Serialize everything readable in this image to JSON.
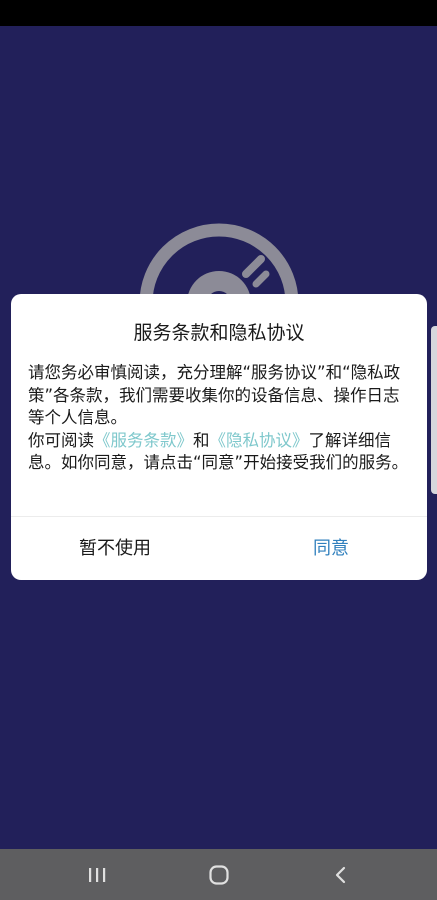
{
  "dialog": {
    "title": "服务条款和隐私协议",
    "body_line1": "请您务必审慎阅读，充分理解“服务协议”和“隐私政策”各条款，我们需要收集你的设备信息、操作日志等个人信息。",
    "body_prefix": "你可阅读",
    "link_terms": "《服务条款》",
    "body_and": "和",
    "link_privacy": "《隐私协议》",
    "body_suffix": "了解详细信息。如你同意，请点击“同意”开始接受我们的服务。",
    "decline_label": "暂不使用",
    "agree_label": "同意"
  },
  "nav": {
    "recents_icon": "recents-icon",
    "home_icon": "home-icon",
    "back_icon": "back-icon"
  },
  "colors": {
    "background": "#22205a",
    "accent": "#2f7fbd",
    "link": "#7fc8cc",
    "nav_bar": "#5e5e60"
  },
  "logo": {
    "icon": "disc-icon"
  }
}
